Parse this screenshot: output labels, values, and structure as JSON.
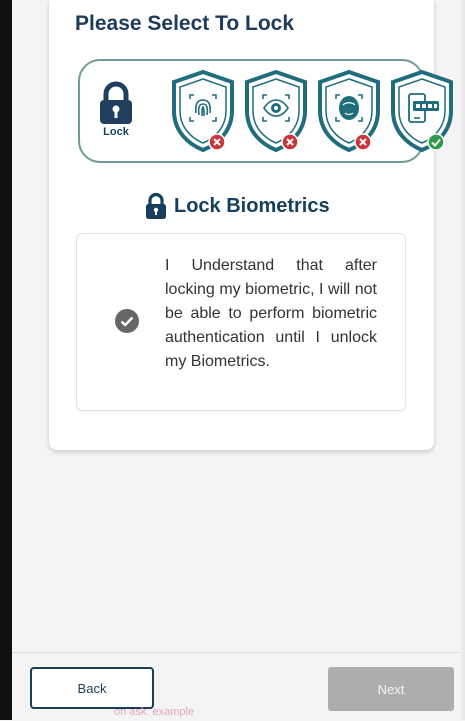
{
  "header": {
    "title": "Please Select To Lock"
  },
  "lock_tab": {
    "label": "Lock",
    "icon": "padlock-icon"
  },
  "options": [
    {
      "name": "fingerprint",
      "icon": "fingerprint-shield-icon",
      "status": "unavailable",
      "badge_icon": "red-x-icon"
    },
    {
      "name": "iris",
      "icon": "eye-shield-icon",
      "status": "unavailable",
      "badge_icon": "red-x-icon"
    },
    {
      "name": "face",
      "icon": "face-shield-icon",
      "status": "unavailable",
      "badge_icon": "red-x-icon"
    },
    {
      "name": "device",
      "icon": "device-shield-icon",
      "status": "selected",
      "badge_icon": "green-check-icon"
    }
  ],
  "section": {
    "title": "Lock Biometrics",
    "icon": "padlock-icon"
  },
  "consent": {
    "text": "I Understand that after locking my biometric, I will not be able to perform biometric authentication until I unlock my Biometrics.",
    "checked": true
  },
  "footer": {
    "back_label": "Back",
    "next_label": "Next",
    "watermark": "on ask. example"
  },
  "colors": {
    "primary": "#1c3c5a",
    "teal": "#1f6d7d",
    "border": "#6f9c97",
    "error": "#c8363c",
    "success": "#2e9a49",
    "disabled": "#adadad"
  }
}
